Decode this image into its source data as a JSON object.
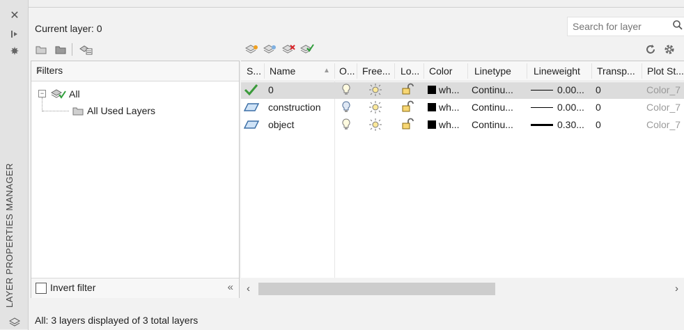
{
  "palette": {
    "title": "LAYER PROPERTIES MANAGER"
  },
  "current_layer": "Current layer: 0",
  "search": {
    "placeholder": "Search for layer"
  },
  "filters": {
    "header": "Filters",
    "tree": [
      {
        "label": "All"
      },
      {
        "label": "All Used Layers"
      }
    ],
    "invert_label": "Invert filter"
  },
  "columns": [
    "S...",
    "Name",
    "O...",
    "Free...",
    "Lo...",
    "Color",
    "Linetype",
    "Lineweight",
    "Transp...",
    "Plot St..."
  ],
  "layers": [
    {
      "name": "0",
      "color": "wh...",
      "linetype": "Continu...",
      "lineweight": "0.00...",
      "transparency": "0",
      "plot_style": "Color_7",
      "selected": true
    },
    {
      "name": "construction",
      "color": "wh...",
      "linetype": "Continu...",
      "lineweight": "0.00...",
      "transparency": "0",
      "plot_style": "Color_7",
      "selected": false
    },
    {
      "name": "object",
      "color": "wh...",
      "linetype": "Continu...",
      "lineweight": "0.30...",
      "transparency": "0",
      "plot_style": "Color_7",
      "selected": false
    }
  ],
  "status": "All: 3 layers displayed of 3 total layers",
  "icons": [
    "close-icon",
    "pin-icon",
    "settings-icon",
    "new-filter-icon",
    "group-filter-icon",
    "state-manager-icon",
    "new-layer-icon",
    "new-vp-frozen-layer-icon",
    "delete-layer-icon",
    "set-current-icon",
    "refresh-icon",
    "gear-icon",
    "search-icon",
    "current-check-icon",
    "layer-parallelogram-icon",
    "lightbulb-icon",
    "sun-icon",
    "unlock-icon"
  ]
}
